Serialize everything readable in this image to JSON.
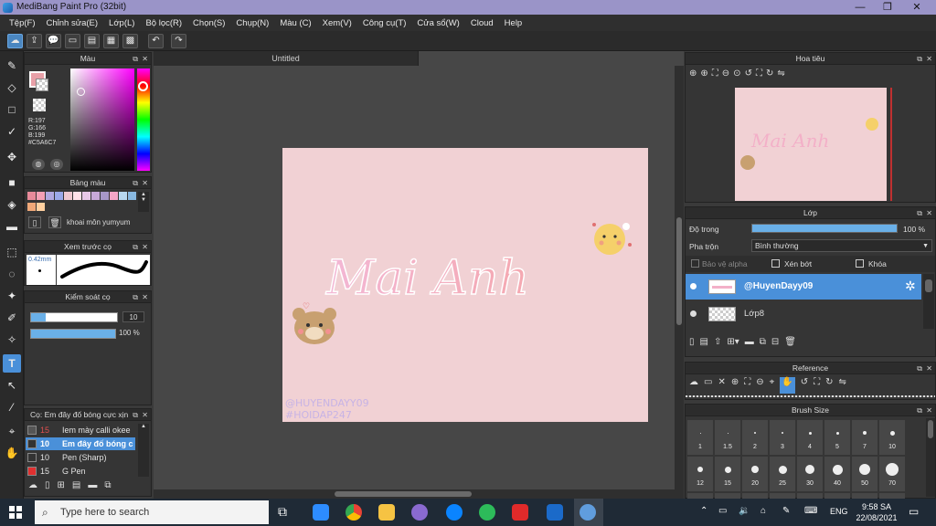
{
  "title": "MediBang Paint Pro (32bit)",
  "window_controls": [
    "—",
    "❐",
    "✕"
  ],
  "menu": [
    "Tệp(F)",
    "Chỉnh sửa(E)",
    "Lớp(L)",
    "Bộ lọc(R)",
    "Chọn(S)",
    "Chụp(N)",
    "Màu (C)",
    "Xem(V)",
    "Công cụ(T)",
    "Cửa sổ(W)",
    "Cloud",
    "Help"
  ],
  "color_panel": {
    "title": "Màu",
    "r": "R:197",
    "g": "G:166",
    "b": "B:199",
    "hex": "#C5A6C7",
    "primary_color": "#e8a0a8"
  },
  "palette_panel": {
    "title": "Bảng màu",
    "palette_name": "khoai môn yumyum",
    "swatches": [
      "#e88a9a",
      "#f5a0b5",
      "#b0a8e0",
      "#9aa8e8",
      "#f0c8d0",
      "#ffe0e8",
      "#e8c8e8",
      "#c8a8d8",
      "#a898c8",
      "#f4a6c8",
      "#b8d8f0",
      "#88b8e0",
      "#f0a878",
      "#ffd0a0"
    ]
  },
  "brush_preview": {
    "title": "Xem trước cọ",
    "size": "0.42mm"
  },
  "brush_control": {
    "title": "Kiểm soát cọ",
    "size_value": "10",
    "opacity_value": "100 %"
  },
  "brush_list": {
    "title": "Cọ: Em đây đố bóng cực xịn",
    "items": [
      {
        "size": "15",
        "name": "Iem mày calli okee",
        "color": "#555555"
      },
      {
        "size": "10",
        "name": "Em đây đố bóng c",
        "color": "#333333"
      },
      {
        "size": "10",
        "name": "Pen (Sharp)",
        "color": "#333333"
      },
      {
        "size": "15",
        "name": "G Pen",
        "color": "#e03030"
      }
    ]
  },
  "document": {
    "tab": "Untitled",
    "canvas_text": "Mai Anh",
    "watermark_1": "@HUYENDAYY09",
    "watermark_2": "#HOIDAP247"
  },
  "navigator": {
    "title": "Hoa tiêu"
  },
  "layer_panel": {
    "title": "Lớp",
    "opacity_label": "Độ trong",
    "opacity_value": "100 %",
    "opacity_fraction": 1.0,
    "blend_label": "Pha trộn",
    "blend_value": "Bình thường",
    "protect_alpha": "Bảo vệ alpha",
    "clipping": "Xén bớt",
    "lock": "Khóa",
    "layers": [
      {
        "name": "@HuyenDayy09",
        "selected": true
      },
      {
        "name": "Lớp8",
        "selected": false
      }
    ]
  },
  "reference_panel": {
    "title": "Reference"
  },
  "brush_size_panel": {
    "title": "Brush Size",
    "sizes_row1": [
      "1",
      "1.5",
      "2",
      "3",
      "4",
      "5",
      "7",
      "10"
    ],
    "sizes_row2": [
      "12",
      "15",
      "20",
      "25",
      "30",
      "40",
      "50",
      "70"
    ]
  },
  "taskbar": {
    "search_placeholder": "Type here to search",
    "language": "ENG",
    "time": "9:58 SA",
    "date": "22/08/2021"
  }
}
